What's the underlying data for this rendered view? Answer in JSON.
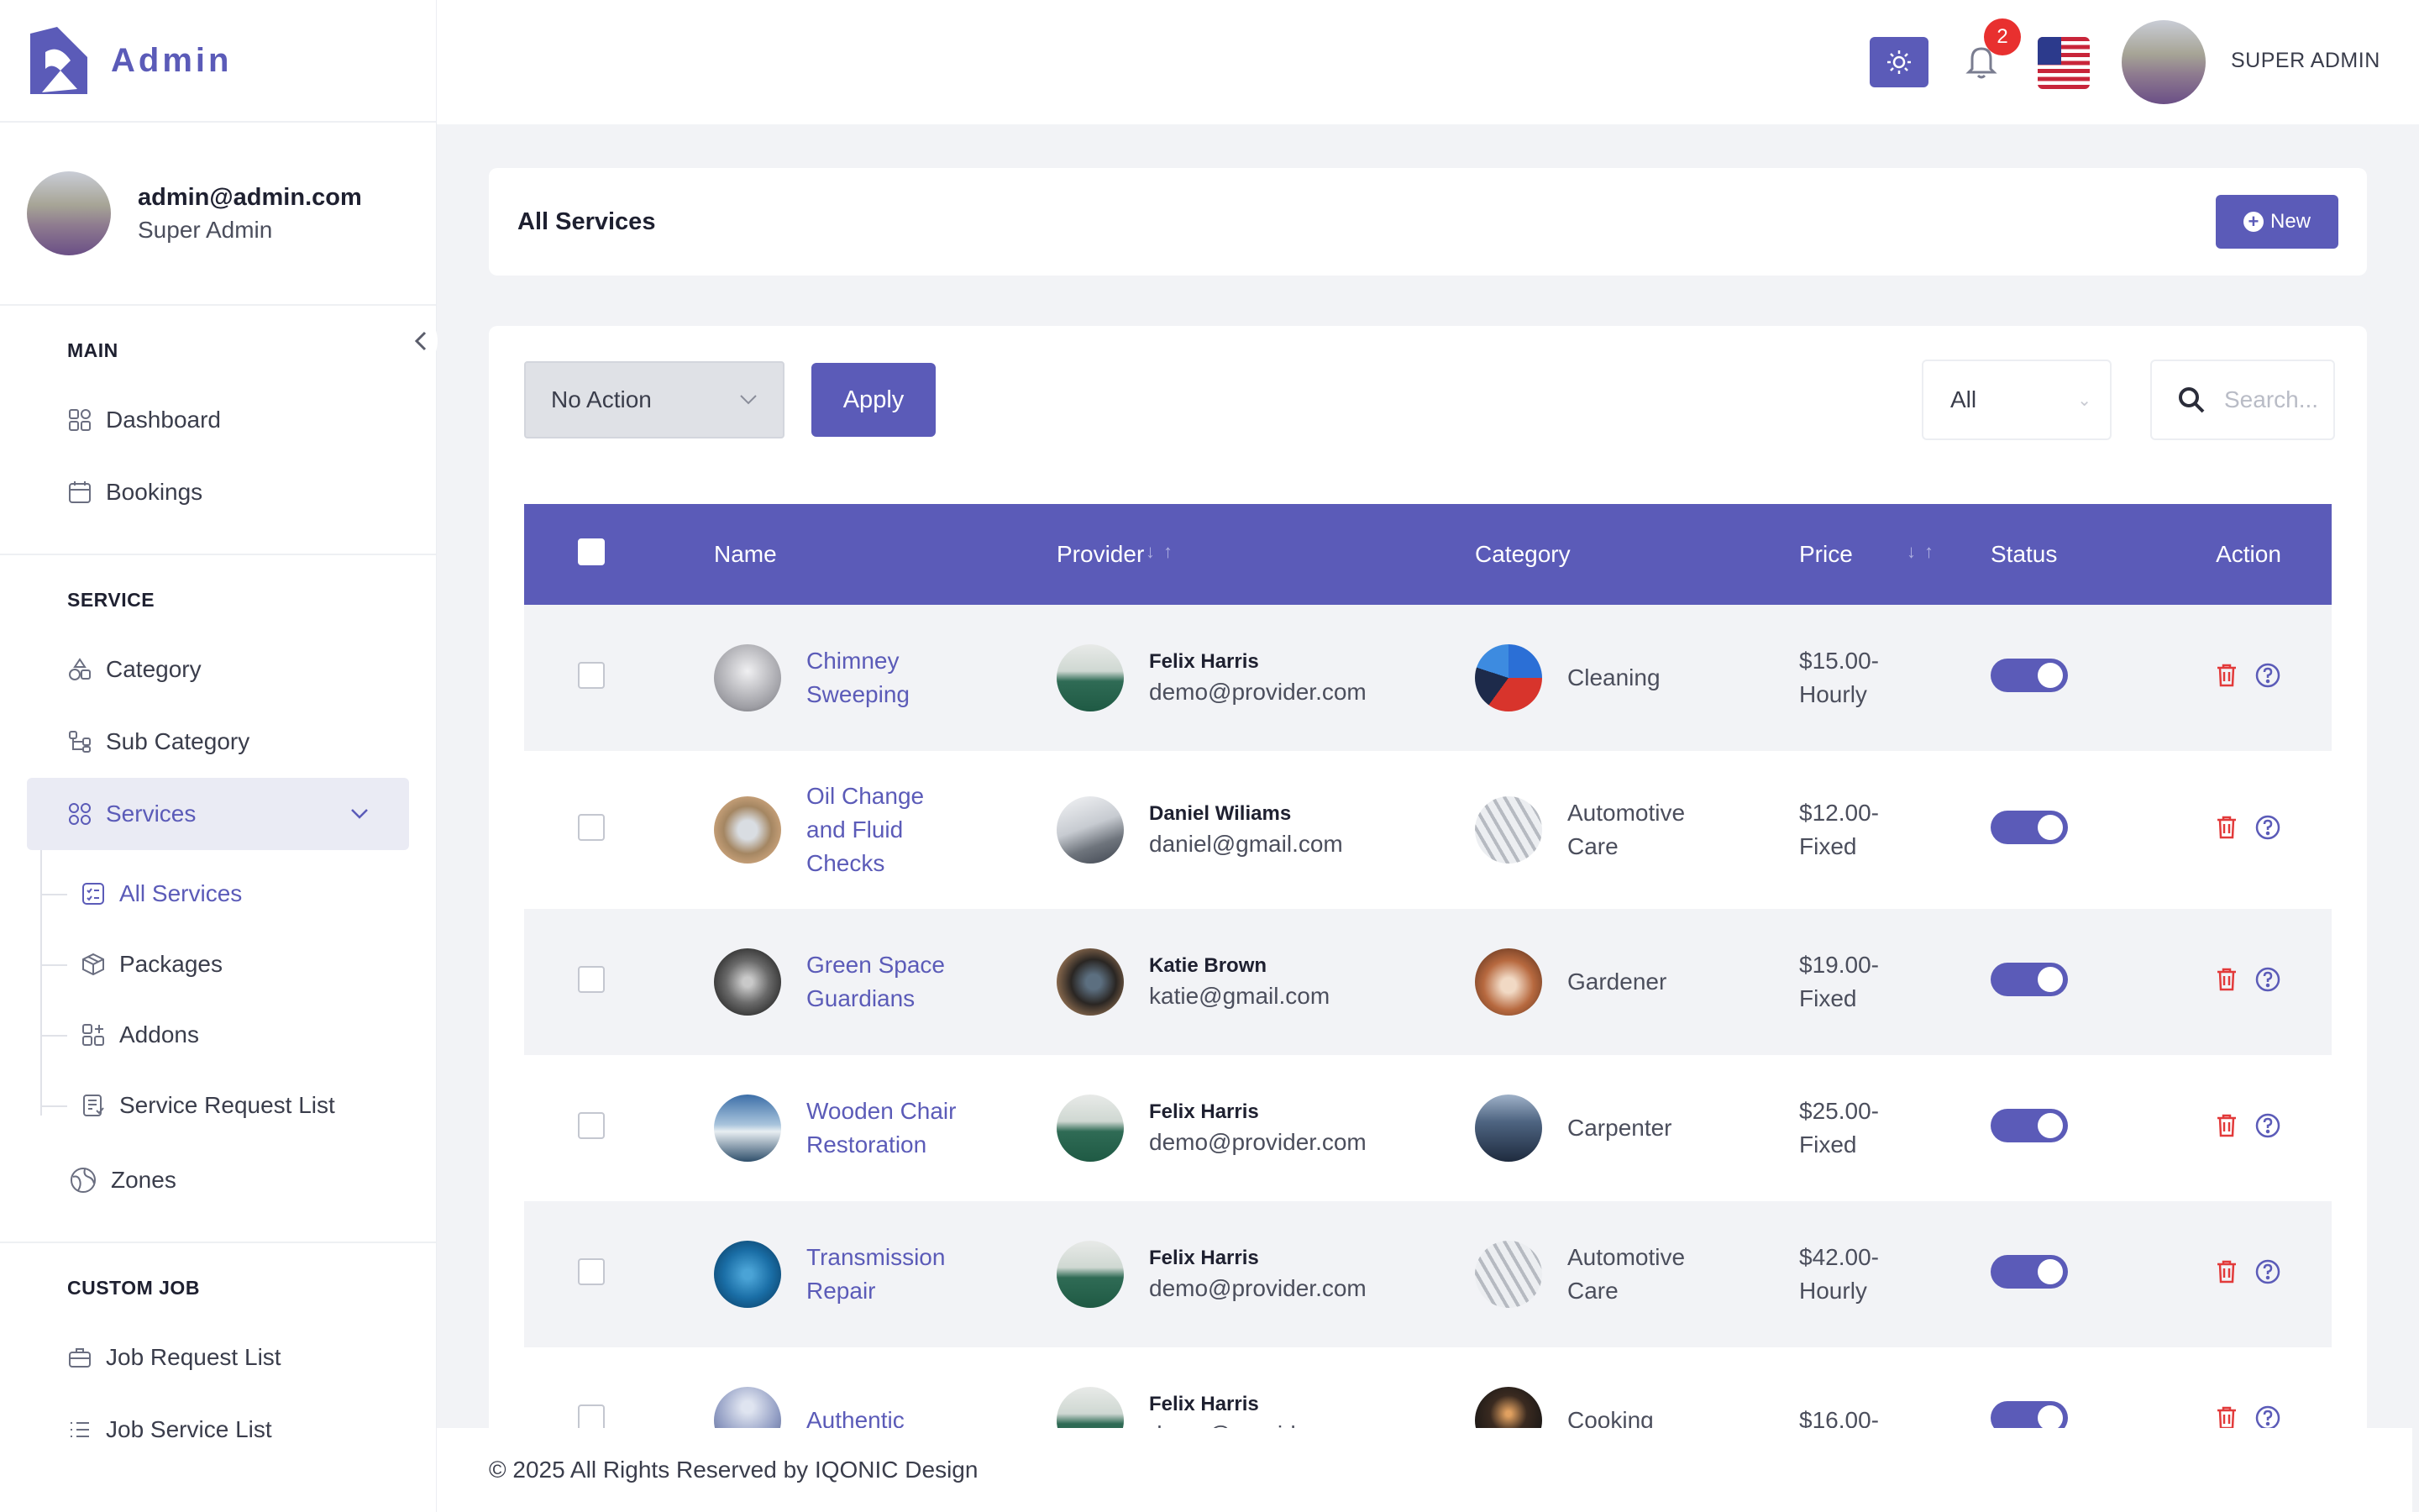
{
  "brand": {
    "name": "Admin",
    "accent": "#5b5bb8"
  },
  "profile": {
    "email": "admin@admin.com",
    "role": "Super Admin"
  },
  "sidebar": {
    "sections": [
      {
        "title": "MAIN",
        "items": [
          {
            "label": "Dashboard",
            "icon": "dashboard-icon"
          },
          {
            "label": "Bookings",
            "icon": "calendar-icon"
          }
        ]
      },
      {
        "title": "SERVICE",
        "items": [
          {
            "label": "Category",
            "icon": "shapes-icon"
          },
          {
            "label": "Sub Category",
            "icon": "tree-icon"
          },
          {
            "label": "Services",
            "icon": "grid-icon",
            "active": true
          }
        ]
      }
    ],
    "services_sub": [
      {
        "label": "All Services",
        "active": true
      },
      {
        "label": "Packages"
      },
      {
        "label": "Addons"
      },
      {
        "label": "Service Request List"
      }
    ],
    "zones_label": "Zones",
    "custom_job": {
      "title": "CUSTOM JOB",
      "items": [
        {
          "label": "Job Request List"
        },
        {
          "label": "Job Service List"
        }
      ]
    }
  },
  "header": {
    "notification_count": "2",
    "user_label": "SUPER ADMIN"
  },
  "page": {
    "title": "All Services",
    "new_label": "New"
  },
  "toolbar": {
    "bulk_action": "No Action",
    "apply_label": "Apply",
    "filter_value": "All",
    "search_placeholder": "Search..."
  },
  "table": {
    "columns": [
      "Name",
      "Provider",
      "Category",
      "Price",
      "Status",
      "Action"
    ],
    "rows": [
      {
        "name": "Chimney Sweeping",
        "provider": "Felix Harris",
        "email": "demo@provider.com",
        "category": "Cleaning",
        "price": "$15.00-Hourly",
        "status": true
      },
      {
        "name": "Oil Change and Fluid Checks",
        "provider": "Daniel Wiliams",
        "email": "daniel@gmail.com",
        "category": "Automotive Care",
        "price": "$12.00-Fixed",
        "status": true
      },
      {
        "name": "Green Space Guardians",
        "provider": "Katie Brown",
        "email": "katie@gmail.com",
        "category": "Gardener",
        "price": "$19.00-Fixed",
        "status": true
      },
      {
        "name": "Wooden Chair Restoration",
        "provider": "Felix Harris",
        "email": "demo@provider.com",
        "category": "Carpenter",
        "price": "$25.00-Fixed",
        "status": true
      },
      {
        "name": "Transmission Repair",
        "provider": "Felix Harris",
        "email": "demo@provider.com",
        "category": "Automotive Care",
        "price": "$42.00-Hourly",
        "status": true
      },
      {
        "name": "Authentic",
        "provider": "Felix Harris",
        "email": "demo@provid",
        "category": "Cooking",
        "price": "$16.00-",
        "status": true
      }
    ]
  },
  "footer": {
    "text": "© 2025 All Rights Reserved by IQONIC Design"
  }
}
